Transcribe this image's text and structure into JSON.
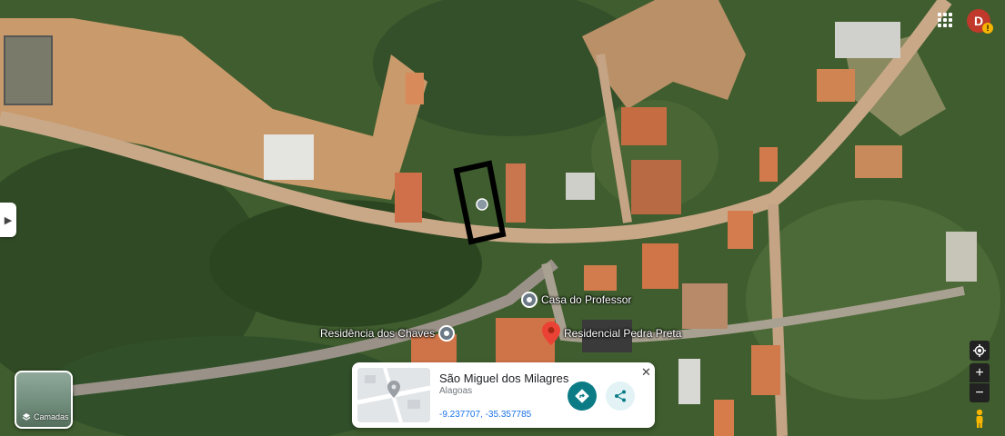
{
  "map": {
    "type": "satellite",
    "places": [
      {
        "name": "Casa do Professor",
        "icon": "place-pin-icon"
      },
      {
        "name": "Residência dos Chaves",
        "icon": "place-pin-icon"
      },
      {
        "name": "Residencial Pedra Preta",
        "icon": "red-marker-icon",
        "color": "#ea4335"
      }
    ]
  },
  "account": {
    "initial": "D",
    "avatar_color": "#c0392b",
    "warning": "!"
  },
  "layers": {
    "label": "Camadas"
  },
  "controls": {
    "zoom_in": "+",
    "zoom_out": "−"
  },
  "info_card": {
    "title": "São Miguel dos Milagres",
    "subtitle": "Alagoas",
    "coordinates": "-9.237707, -35.357785",
    "close": "✕"
  }
}
